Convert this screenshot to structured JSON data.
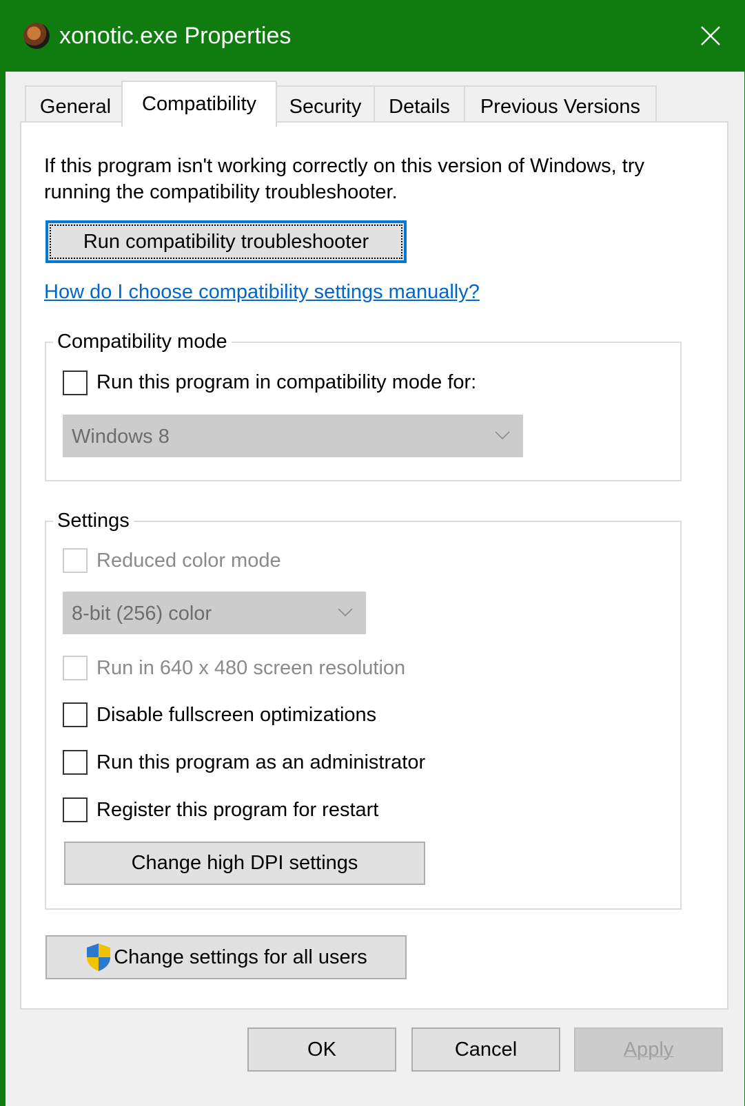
{
  "window": {
    "title": "xonotic.exe Properties",
    "accent_color": "#107c10",
    "app_icon": "xonotic-app-icon",
    "close_icon": "close-icon"
  },
  "tabs": [
    {
      "label": "General",
      "active": false
    },
    {
      "label": "Compatibility",
      "active": true
    },
    {
      "label": "Security",
      "active": false
    },
    {
      "label": "Details",
      "active": false
    },
    {
      "label": "Previous Versions",
      "active": false
    }
  ],
  "compat": {
    "intro_line1": "If this program isn't working correctly on this version of Windows, try",
    "intro_line2": "running the compatibility troubleshooter.",
    "troubleshooter_button": "Run compatibility troubleshooter",
    "help_link": "How do I choose compatibility settings manually?",
    "mode_group": {
      "legend": "Compatibility mode",
      "checkbox_label": "Run this program in compatibility mode for:",
      "checked": false,
      "select_value": "Windows 8"
    },
    "settings_group": {
      "legend": "Settings",
      "reduced_color_label": "Reduced color mode",
      "color_select_value": "8-bit (256) color",
      "res_640_label": "Run in 640 x 480 screen resolution",
      "disable_fullscreen_label": "Disable fullscreen optimizations",
      "run_as_admin_label": "Run this program as an administrator",
      "register_restart_label": "Register this program for restart",
      "dpi_button": "Change high DPI settings"
    },
    "all_users_button": "Change settings for all users",
    "shield_icon": "uac-shield-icon"
  },
  "footer": {
    "ok": "OK",
    "cancel": "Cancel",
    "apply": "Apply"
  }
}
